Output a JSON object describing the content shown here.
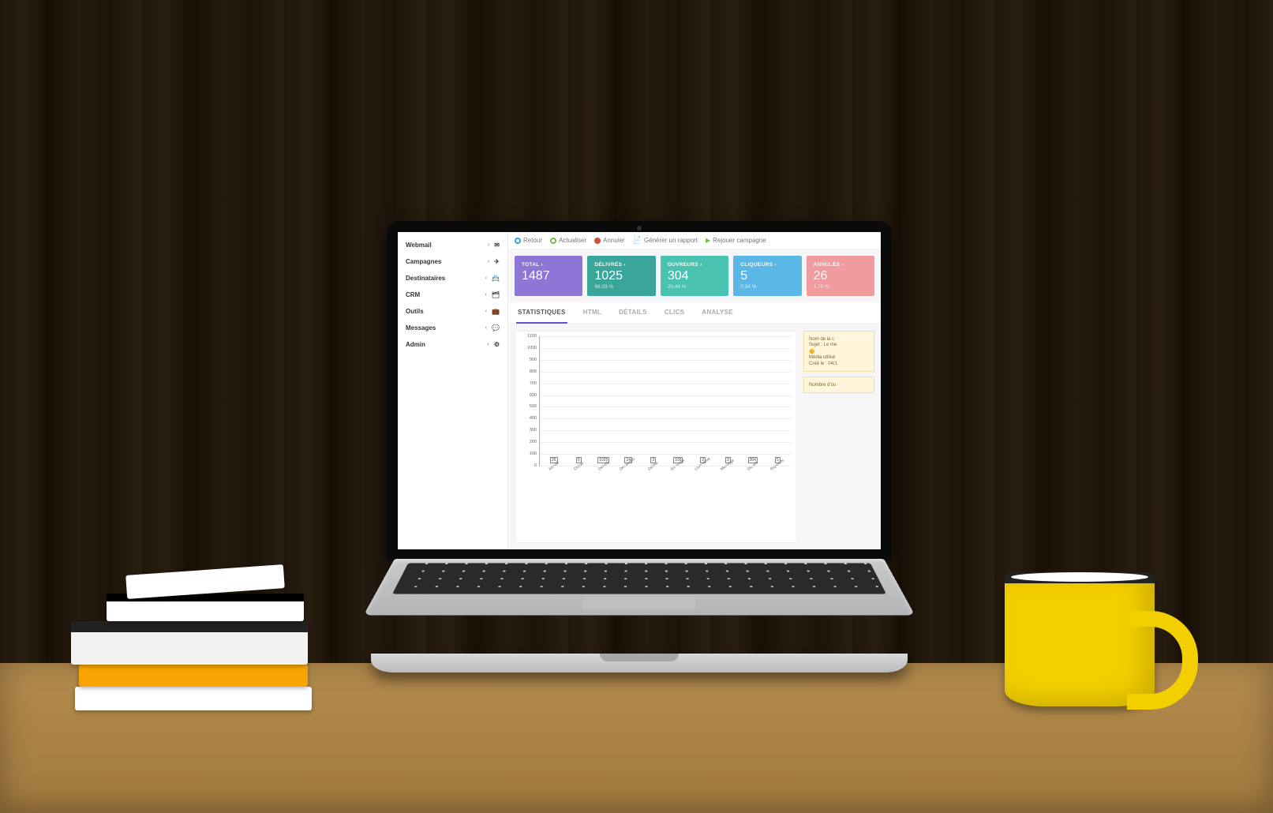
{
  "sidebar": {
    "items": [
      {
        "label": "Webmail",
        "icon": "✉"
      },
      {
        "label": "Campagnes",
        "icon": "✈"
      },
      {
        "label": "Destinataires",
        "icon": "📇"
      },
      {
        "label": "CRM",
        "icon": "🗂"
      },
      {
        "label": "Outils",
        "icon": "💼"
      },
      {
        "label": "Messages",
        "icon": "💬"
      },
      {
        "label": "Admin",
        "icon": "⚙"
      }
    ]
  },
  "toolbar": {
    "back": "Retour",
    "refresh": "Actualiser",
    "cancel": "Annuler",
    "report": "Générer un rapport",
    "replay": "Rejouer campagne"
  },
  "cards": [
    {
      "title": "TOTAL ›",
      "value": "1487",
      "pct": ""
    },
    {
      "title": "DÉLIVRÉS ›",
      "value": "1025",
      "pct": "68,93 %"
    },
    {
      "title": "OUVREURS ›",
      "value": "304",
      "pct": "20,44 %"
    },
    {
      "title": "CLIQUEURS ›",
      "value": "5",
      "pct": "0,34 %"
    },
    {
      "title": "ANNULÉS ›",
      "value": "26",
      "pct": "1,75 %"
    }
  ],
  "tabs": [
    "STATISTIQUES",
    "HTML",
    "DÉTAILS",
    "CLICS",
    "ANALYSE"
  ],
  "active_tab": "STATISTIQUES",
  "info_panel": {
    "rows": [
      "Nom de la c",
      "Sujet : Le me",
      "😊",
      "Média utilisé",
      "Créé le : 04/1"
    ],
    "footer": "Nombre d'ou"
  },
  "chart_data": {
    "type": "bar",
    "categories": [
      "Annulé",
      "Cliqué",
      "Délivré",
      "Désabonn.",
      "Différé",
      "En erreur",
      "Liste Noire",
      "Message",
      "Ouvert",
      "Rapports"
    ],
    "values": [
      26,
      5,
      1025,
      14,
      3,
      100,
      2,
      3,
      304,
      5
    ],
    "ylabel": "",
    "ylim": [
      0,
      1100
    ],
    "yticks": [
      0,
      100,
      200,
      300,
      400,
      500,
      600,
      700,
      800,
      900,
      1000,
      1100
    ]
  }
}
